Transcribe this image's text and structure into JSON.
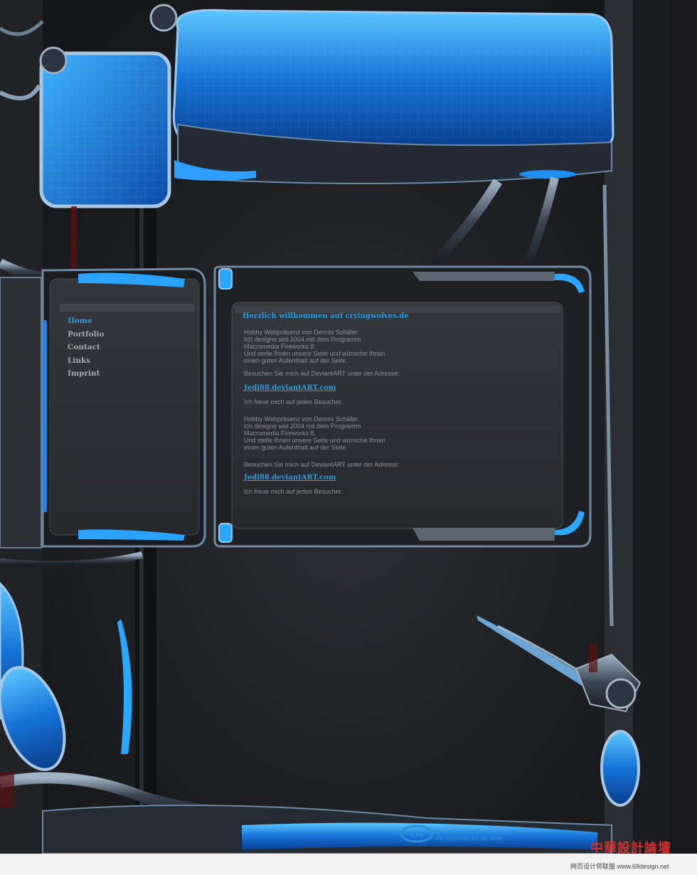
{
  "nav": {
    "items": [
      {
        "label": "Home",
        "active": true
      },
      {
        "label": "Portfolio",
        "active": false
      },
      {
        "label": "Contact",
        "active": false
      },
      {
        "label": "Links",
        "active": false
      },
      {
        "label": "Imprint",
        "active": false
      }
    ]
  },
  "content": {
    "title": "Herzlich willkommen auf cryingwolves.de",
    "p1": [
      "Hobby Webpräsenz von Dennis Schäfer.",
      "Ich designe seit 2004 mit dem Programm",
      "Macromedia Fireworks 8.",
      "Und stelle Ihnen unsere Seite und wünsche Ihnen",
      "einen guten Aufenthalt auf der Seite."
    ],
    "p2": "Besuchen Sie mich auf DeviantART unter der Adresse:",
    "link1": "Jedi88.deviantART.com",
    "p3": "Ich freue mich auf jeden Besucher.",
    "p4": [
      "Hobby Webpräsenz von Dennis Schäfer.",
      "Ich designe seit 2004 mit dem Programm",
      "Macromedia Fireworks 8.",
      "Und stelle Ihnen unsere Seite und wünsche Ihnen",
      "einen guten Aufenthalt auf der Seite."
    ],
    "p5": "Besuchen Sie mich auf DeviantART unter der Adresse:",
    "link2": "Jedi88.deviantART.com",
    "p6": "Ich freue mich auf jeden Besucher."
  },
  "footer": {
    "logo_text": "CW",
    "credit_line1": "DESIGN CREATED BY",
    "credit_line2": "CRYINGWOLVES.DE 2006"
  },
  "watermark": {
    "forum": "中華設計論壇",
    "url": "网页设计师联盟 www.68design.net"
  },
  "colors": {
    "accent_blue": "#2d9be0",
    "background": "#1d1f22",
    "panel": "#2a2c30"
  }
}
